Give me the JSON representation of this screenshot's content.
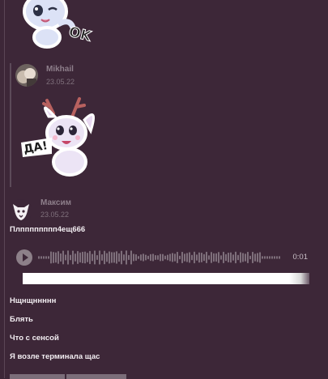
{
  "messages": [
    {
      "kind": "sticker",
      "sticker_name": "white cat sticker with OK",
      "caption": "OK"
    },
    {
      "kind": "quoted_sticker",
      "author": "Mikhail",
      "date": "23.05.22",
      "sticker_name": "deer sticker saying DA",
      "caption": "ДА!"
    },
    {
      "kind": "post",
      "author": "Максим",
      "date": "23.05.22",
      "text": "Плпппппппп4ещ666",
      "voice": {
        "duration": "0:01",
        "progress": 0
      },
      "lines": [
        "Нщнщннннн",
        "Блять",
        "Что с сенсой",
        "Я возле терминала щас"
      ]
    }
  ],
  "colors": {
    "background": "#3d2738",
    "text": "#f3eef2",
    "muted": "#8e7f8b"
  }
}
